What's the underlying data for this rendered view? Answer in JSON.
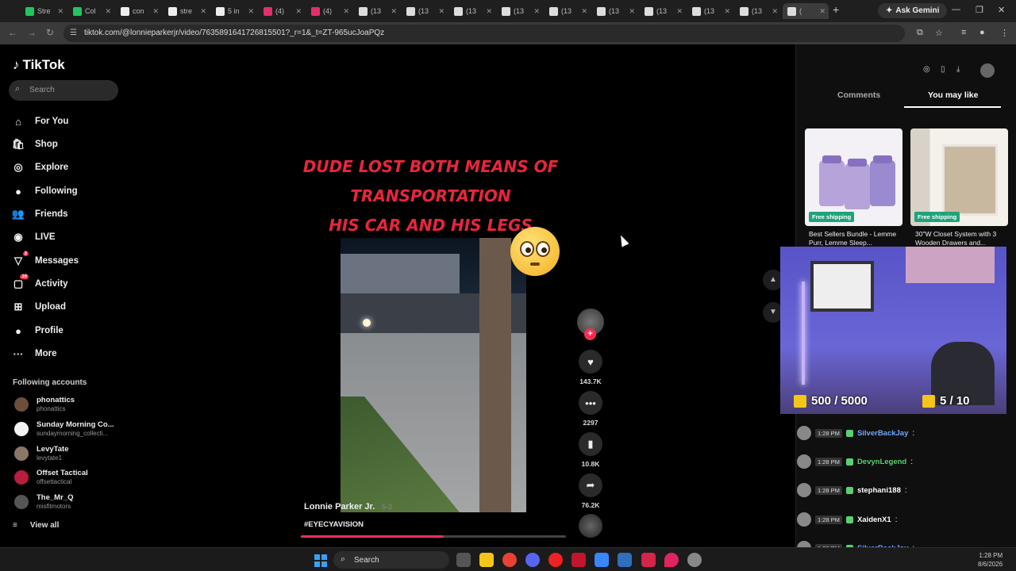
{
  "browser": {
    "tabs": [
      {
        "label": "Stre",
        "color": "#22c55e"
      },
      {
        "label": "Col",
        "color": "#22c55e"
      },
      {
        "label": "con",
        "color": "#eeeeee"
      },
      {
        "label": "stre",
        "color": "#eeeeee"
      },
      {
        "label": "5 in",
        "color": "#eeeeee"
      },
      {
        "label": "(4)",
        "color": "#e1306c"
      },
      {
        "label": "(4)",
        "color": "#e1306c"
      },
      {
        "label": "(13",
        "color": "#dddddd"
      },
      {
        "label": "(13",
        "color": "#dddddd"
      },
      {
        "label": "(13",
        "color": "#dddddd"
      },
      {
        "label": "(13",
        "color": "#dddddd"
      },
      {
        "label": "(13",
        "color": "#dddddd"
      },
      {
        "label": "(13",
        "color": "#dddddd"
      },
      {
        "label": "(13",
        "color": "#dddddd"
      },
      {
        "label": "(13",
        "color": "#dddddd"
      },
      {
        "label": "(13",
        "color": "#dddddd"
      },
      {
        "label": "(",
        "color": "#dddddd"
      }
    ],
    "ask_gemini": "Ask Gemini",
    "url": "tiktok.com/@lonnieparkerjr/video/7635891641726815501?_r=1&_t=ZT-965ucJoaPQz"
  },
  "nav": {
    "logo": "TikTok",
    "search_placeholder": "Search",
    "items": [
      {
        "label": "For You",
        "icon": "⌂"
      },
      {
        "label": "Shop",
        "icon": "🛍"
      },
      {
        "label": "Explore",
        "icon": "◎"
      },
      {
        "label": "Following",
        "icon": "●"
      },
      {
        "label": "Friends",
        "icon": "👥"
      },
      {
        "label": "LIVE",
        "icon": "◉"
      },
      {
        "label": "Messages",
        "icon": "▽",
        "badge": "3"
      },
      {
        "label": "Activity",
        "icon": "▢",
        "badge": "10"
      },
      {
        "label": "Upload",
        "icon": "⊞"
      },
      {
        "label": "Profile",
        "icon": "●"
      },
      {
        "label": "More",
        "icon": "···"
      }
    ],
    "following_title": "Following accounts",
    "accounts": [
      {
        "name": "phonattics",
        "handle": "phonattics",
        "color": "#6b4f3a"
      },
      {
        "name": "Sunday Morning Co...",
        "handle": "sundaymorning_collecti...",
        "color": "#f2f2f2"
      },
      {
        "name": "LevyTate",
        "handle": "levytate1",
        "color": "#8a7766"
      },
      {
        "name": "Offset Tactical",
        "handle": "offsettactical",
        "color": "#b91c3c"
      },
      {
        "name": "The_Mr_Q",
        "handle": "misfitmotors",
        "color": "#555555"
      }
    ],
    "view_all": "View all"
  },
  "video": {
    "overlay_lines": [
      "DUDE LOST BOTH MEANS OF",
      "TRANSPORTATION",
      "HIS CAR AND HIS LEGS"
    ],
    "author": "Lonnie Parker Jr.",
    "date": "· 5-3",
    "hashtag": "#EYECYAVISION",
    "progress": 0.54
  },
  "actions": {
    "likes": "143.7K",
    "comments": "2297",
    "saves": "10.8K",
    "shares": "76.2K"
  },
  "right_panel": {
    "tabs": [
      "Comments",
      "You may like"
    ],
    "active_tab": "You may like",
    "products": [
      {
        "badge": "Free shipping",
        "title": "Best Sellers Bundle - Lemme Purr, Lemme Sleep..."
      },
      {
        "badge": "Free shipping",
        "title": "30\"W Closet System with 3 Wooden Drawers and..."
      }
    ]
  },
  "stream": {
    "counter_left": "500 / 5000",
    "counter_right": "5 / 10",
    "chat": [
      {
        "time": "1:28 PM",
        "user": "SilverBackJay",
        "color": "#6fa8ff",
        "msg": ":"
      },
      {
        "time": "1:28 PM",
        "user": "DevynLegend",
        "color": "#5bd06f",
        "msg": ":"
      },
      {
        "time": "1:28 PM",
        "user": "stephani188",
        "color": "#ffffff",
        "msg": ":"
      },
      {
        "time": "1:28 PM",
        "user": "XaidenX1",
        "color": "#ffffff",
        "msg": ":"
      },
      {
        "time": "1:28 PM",
        "user": "SilverBackJay",
        "color": "#6fa8ff",
        "msg": ":"
      }
    ]
  },
  "taskbar": {
    "search_placeholder": "Search",
    "time": "1:28 PM",
    "date": "8/6/2026"
  }
}
